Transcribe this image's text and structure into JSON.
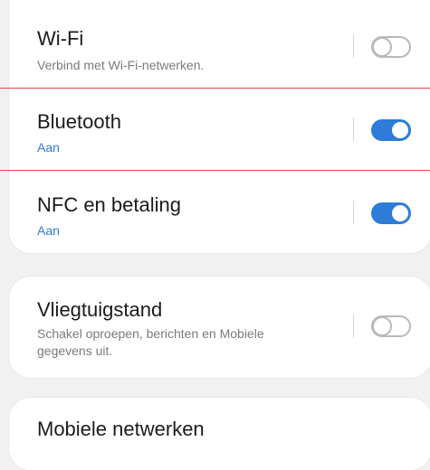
{
  "settings": {
    "wifi": {
      "title": "Wi-Fi",
      "subtitle": "Verbind met Wi-Fi-netwerken.",
      "enabled": false
    },
    "bluetooth": {
      "title": "Bluetooth",
      "subtitle": "Aan",
      "enabled": true
    },
    "nfc": {
      "title": "NFC en betaling",
      "subtitle": "Aan",
      "enabled": true
    },
    "airplane": {
      "title": "Vliegtuigstand",
      "subtitle_line1": "Schakel oproepen, berichten en Mobiele",
      "subtitle_line2": "gegevens uit.",
      "enabled": false
    },
    "mobile": {
      "title": "Mobiele netwerken"
    }
  },
  "colors": {
    "accent": "#2d7cd8",
    "highlight_line": "#e0474a",
    "background": "#f1f1f2"
  }
}
